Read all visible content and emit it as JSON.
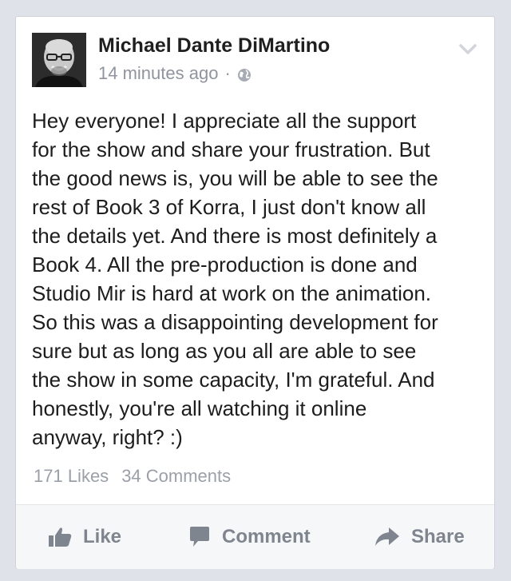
{
  "post": {
    "author": "Michael Dante DiMartino",
    "time": "14 minutes ago",
    "separator": "·",
    "privacy_icon": "globe-icon",
    "options_icon": "chevron-down-icon",
    "text": "Hey everyone! I appreciate all the support\nfor the show and share your frustration. But\nthe good news is, you will be able to see the\nrest of Book 3 of Korra, I just don't know all\nthe details yet. And there is most definitely a\nBook 4. All the pre-production is done and\nStudio Mir is hard at work on the animation.\nSo this was a disappointing development for\nsure but as long as you all are able to see\nthe show in some capacity, I'm grateful. And\nhonestly, you're all watching it online\nanyway, right? :)"
  },
  "stats": {
    "likes": "171 Likes",
    "comments": "34 Comments"
  },
  "actions": {
    "like": "Like",
    "comment": "Comment",
    "share": "Share"
  },
  "colors": {
    "background": "#dfe2e8",
    "card": "#ffffff",
    "text": "#1d1d1d",
    "muted": "#8f949e",
    "action": "#7f858f"
  }
}
